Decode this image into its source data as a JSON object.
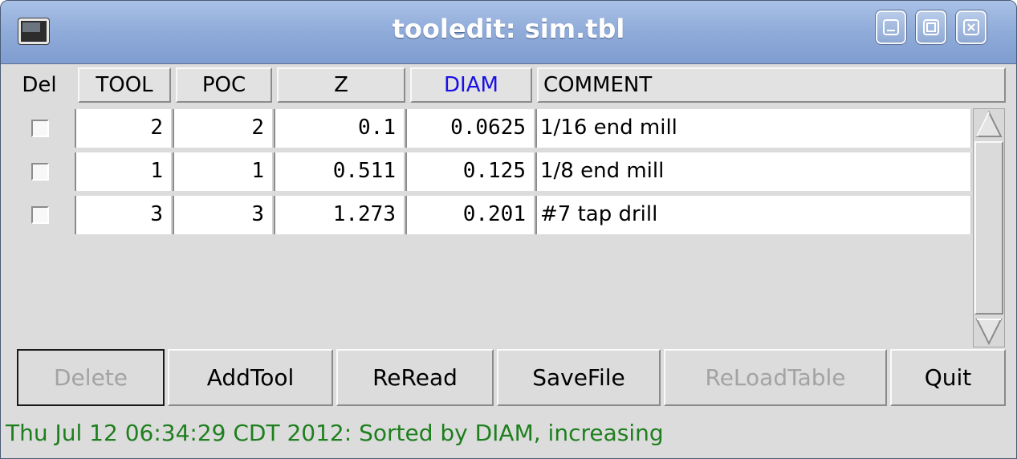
{
  "window": {
    "title": "tooledit: sim.tbl",
    "controls": [
      "minimize-icon",
      "maximize-icon",
      "close-icon"
    ]
  },
  "table": {
    "columns": {
      "del": "Del",
      "tool": "TOOL",
      "poc": "POC",
      "z": "Z",
      "diam": "DIAM",
      "comment": "COMMENT"
    },
    "sorted_column": "DIAM",
    "sorted_color": "#1a10e6",
    "rows": [
      {
        "del": false,
        "tool": "2",
        "poc": "2",
        "z": "0.1",
        "diam": "0.0625",
        "comment": "1/16 end mill"
      },
      {
        "del": false,
        "tool": "1",
        "poc": "1",
        "z": "0.511",
        "diam": "0.125",
        "comment": "1/8 end mill"
      },
      {
        "del": false,
        "tool": "3",
        "poc": "3",
        "z": "1.273",
        "diam": "0.201",
        "comment": "#7 tap drill"
      }
    ]
  },
  "buttons": {
    "delete": "Delete",
    "add_tool": "AddTool",
    "reread": "ReRead",
    "save_file": "SaveFile",
    "reload_table": "ReLoadTable",
    "quit": "Quit"
  },
  "status": {
    "text": "Thu Jul 12 06:34:29 CDT 2012: Sorted by DIAM, increasing",
    "color": "#1d7f1d"
  }
}
